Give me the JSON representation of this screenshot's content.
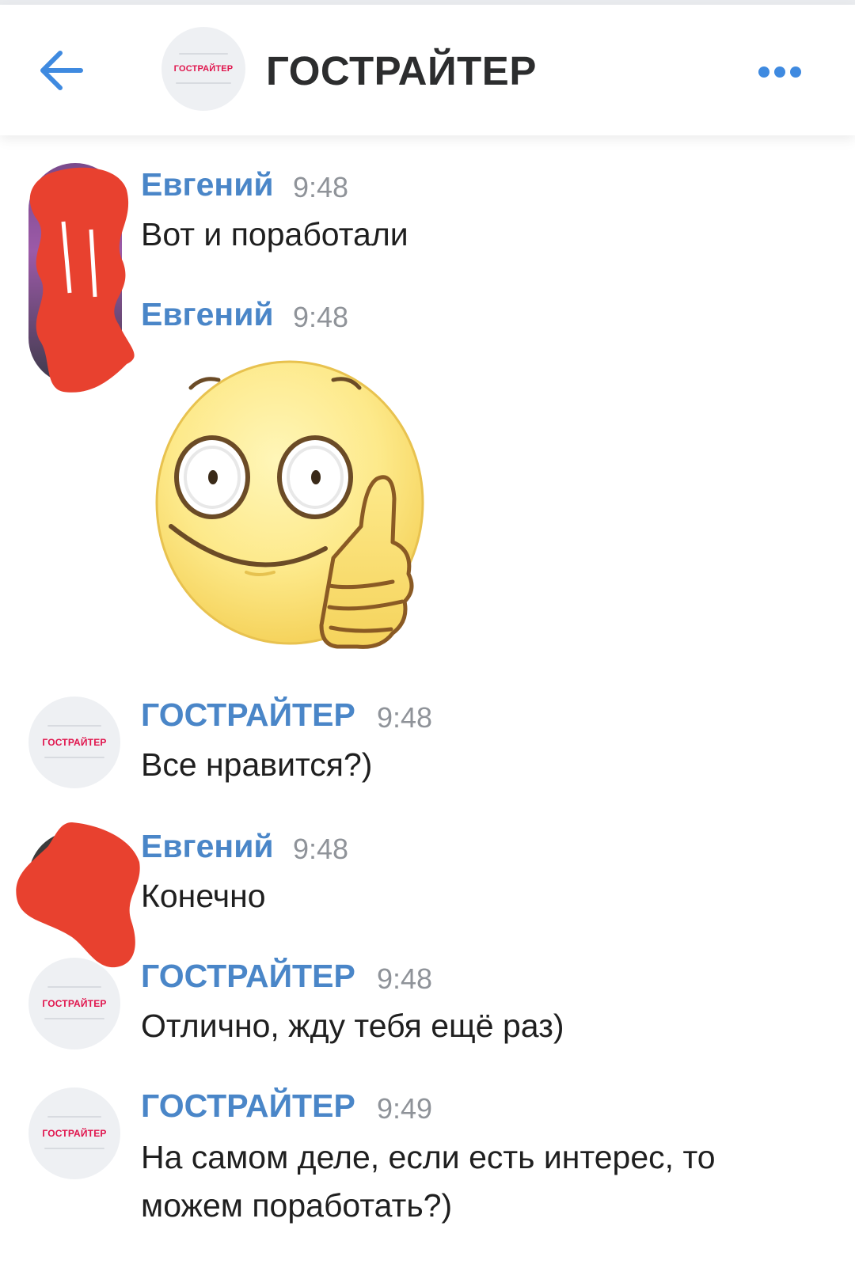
{
  "header": {
    "title": "ГОСТРАЙТЕР",
    "back_icon": "arrow-left-icon",
    "more_icon": "more-dots-icon",
    "avatar_logo": "ГОСТРАЙТЕР",
    "accent_color": "#3f8ae0"
  },
  "messages": [
    {
      "author": "Евгений",
      "time": "9:48",
      "text": "Вот и поработали"
    },
    {
      "author": "Евгений",
      "time": "9:48",
      "sticker": "thumbs-up-smiley-sticker"
    },
    {
      "author": "ГОСТРАЙТЕР",
      "time": "9:48",
      "text": "Все нравится?)"
    },
    {
      "author": "Евгений",
      "time": "9:48",
      "text": "Конечно"
    },
    {
      "author": "ГОСТРАЙТЕР",
      "time": "9:48",
      "text": "Отлично, жду тебя ещё раз)"
    },
    {
      "author": "ГОСТРАЙТЕР",
      "time": "9:49",
      "text_lines": [
        "На самом деле, если есть интерес, то",
        "можем поработать?)"
      ]
    }
  ],
  "colors": {
    "author_name": "#4a86c8",
    "timestamp": "#8f9399",
    "redaction": "#e8412f",
    "logo_red": "#e0144c"
  }
}
